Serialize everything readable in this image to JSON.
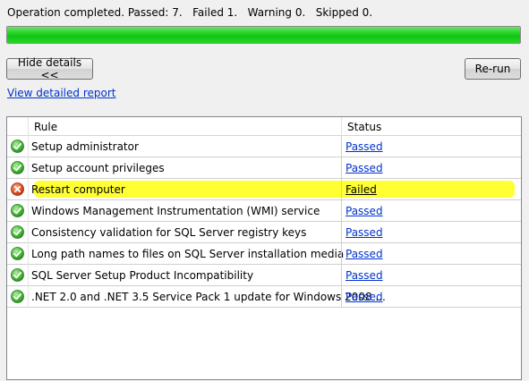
{
  "summary": {
    "text": "Operation completed. Passed: 7.   Failed 1.   Warning 0.   Skipped 0."
  },
  "progress": {
    "value_percent": 100,
    "color": "#1ec81e"
  },
  "buttons": {
    "hide_details": "Hide details <<",
    "rerun": "Re-run"
  },
  "report_link": "View detailed report",
  "table": {
    "columns": {
      "rule": "Rule",
      "status": "Status"
    },
    "rows": [
      {
        "rule": "Setup administrator",
        "status": "Passed",
        "icon": "passed-check-icon"
      },
      {
        "rule": "Setup account privileges",
        "status": "Passed",
        "icon": "passed-check-icon"
      },
      {
        "rule": "Restart computer",
        "status": "Failed",
        "icon": "failed-x-icon",
        "highlighted": true
      },
      {
        "rule": "Windows Management Instrumentation (WMI) service",
        "status": "Passed",
        "icon": "passed-check-icon"
      },
      {
        "rule": "Consistency validation for SQL Server registry keys",
        "status": "Passed",
        "icon": "passed-check-icon"
      },
      {
        "rule": "Long path names to files on SQL Server installation media",
        "status": "Passed",
        "icon": "passed-check-icon"
      },
      {
        "rule": "SQL Server Setup Product Incompatibility",
        "status": "Passed",
        "icon": "passed-check-icon"
      },
      {
        "rule": ".NET 2.0 and .NET 3.5 Service Pack 1 update for Windows 2008 ...",
        "status": "Passed",
        "icon": "passed-check-icon"
      }
    ]
  },
  "colors": {
    "link": "#0033cc",
    "highlight": "#ffff33",
    "passed": "#3aa63a",
    "failed": "#d23a1e"
  }
}
